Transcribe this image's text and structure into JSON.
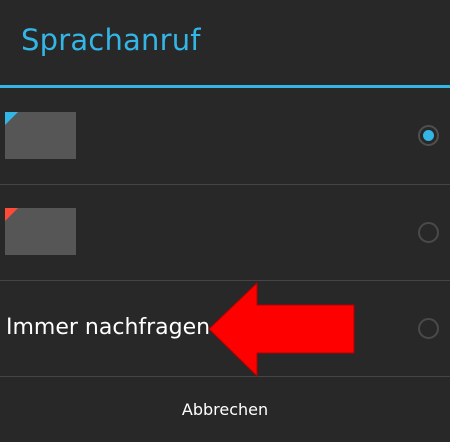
{
  "dialog": {
    "title": "Sprachanruf",
    "accent_color": "#33b5e5"
  },
  "options": [
    {
      "label": "",
      "icon": "sim-card-icon",
      "corner_color": "#33b5e5",
      "selected": true
    },
    {
      "label": "",
      "icon": "sim-card-icon",
      "corner_color": "#ff4b38",
      "selected": false
    },
    {
      "label": "Immer nachfragen",
      "selected": false
    }
  ],
  "annotation": {
    "arrow_color": "#ff0000",
    "direction": "left"
  },
  "footer": {
    "cancel_label": "Abbrechen"
  }
}
